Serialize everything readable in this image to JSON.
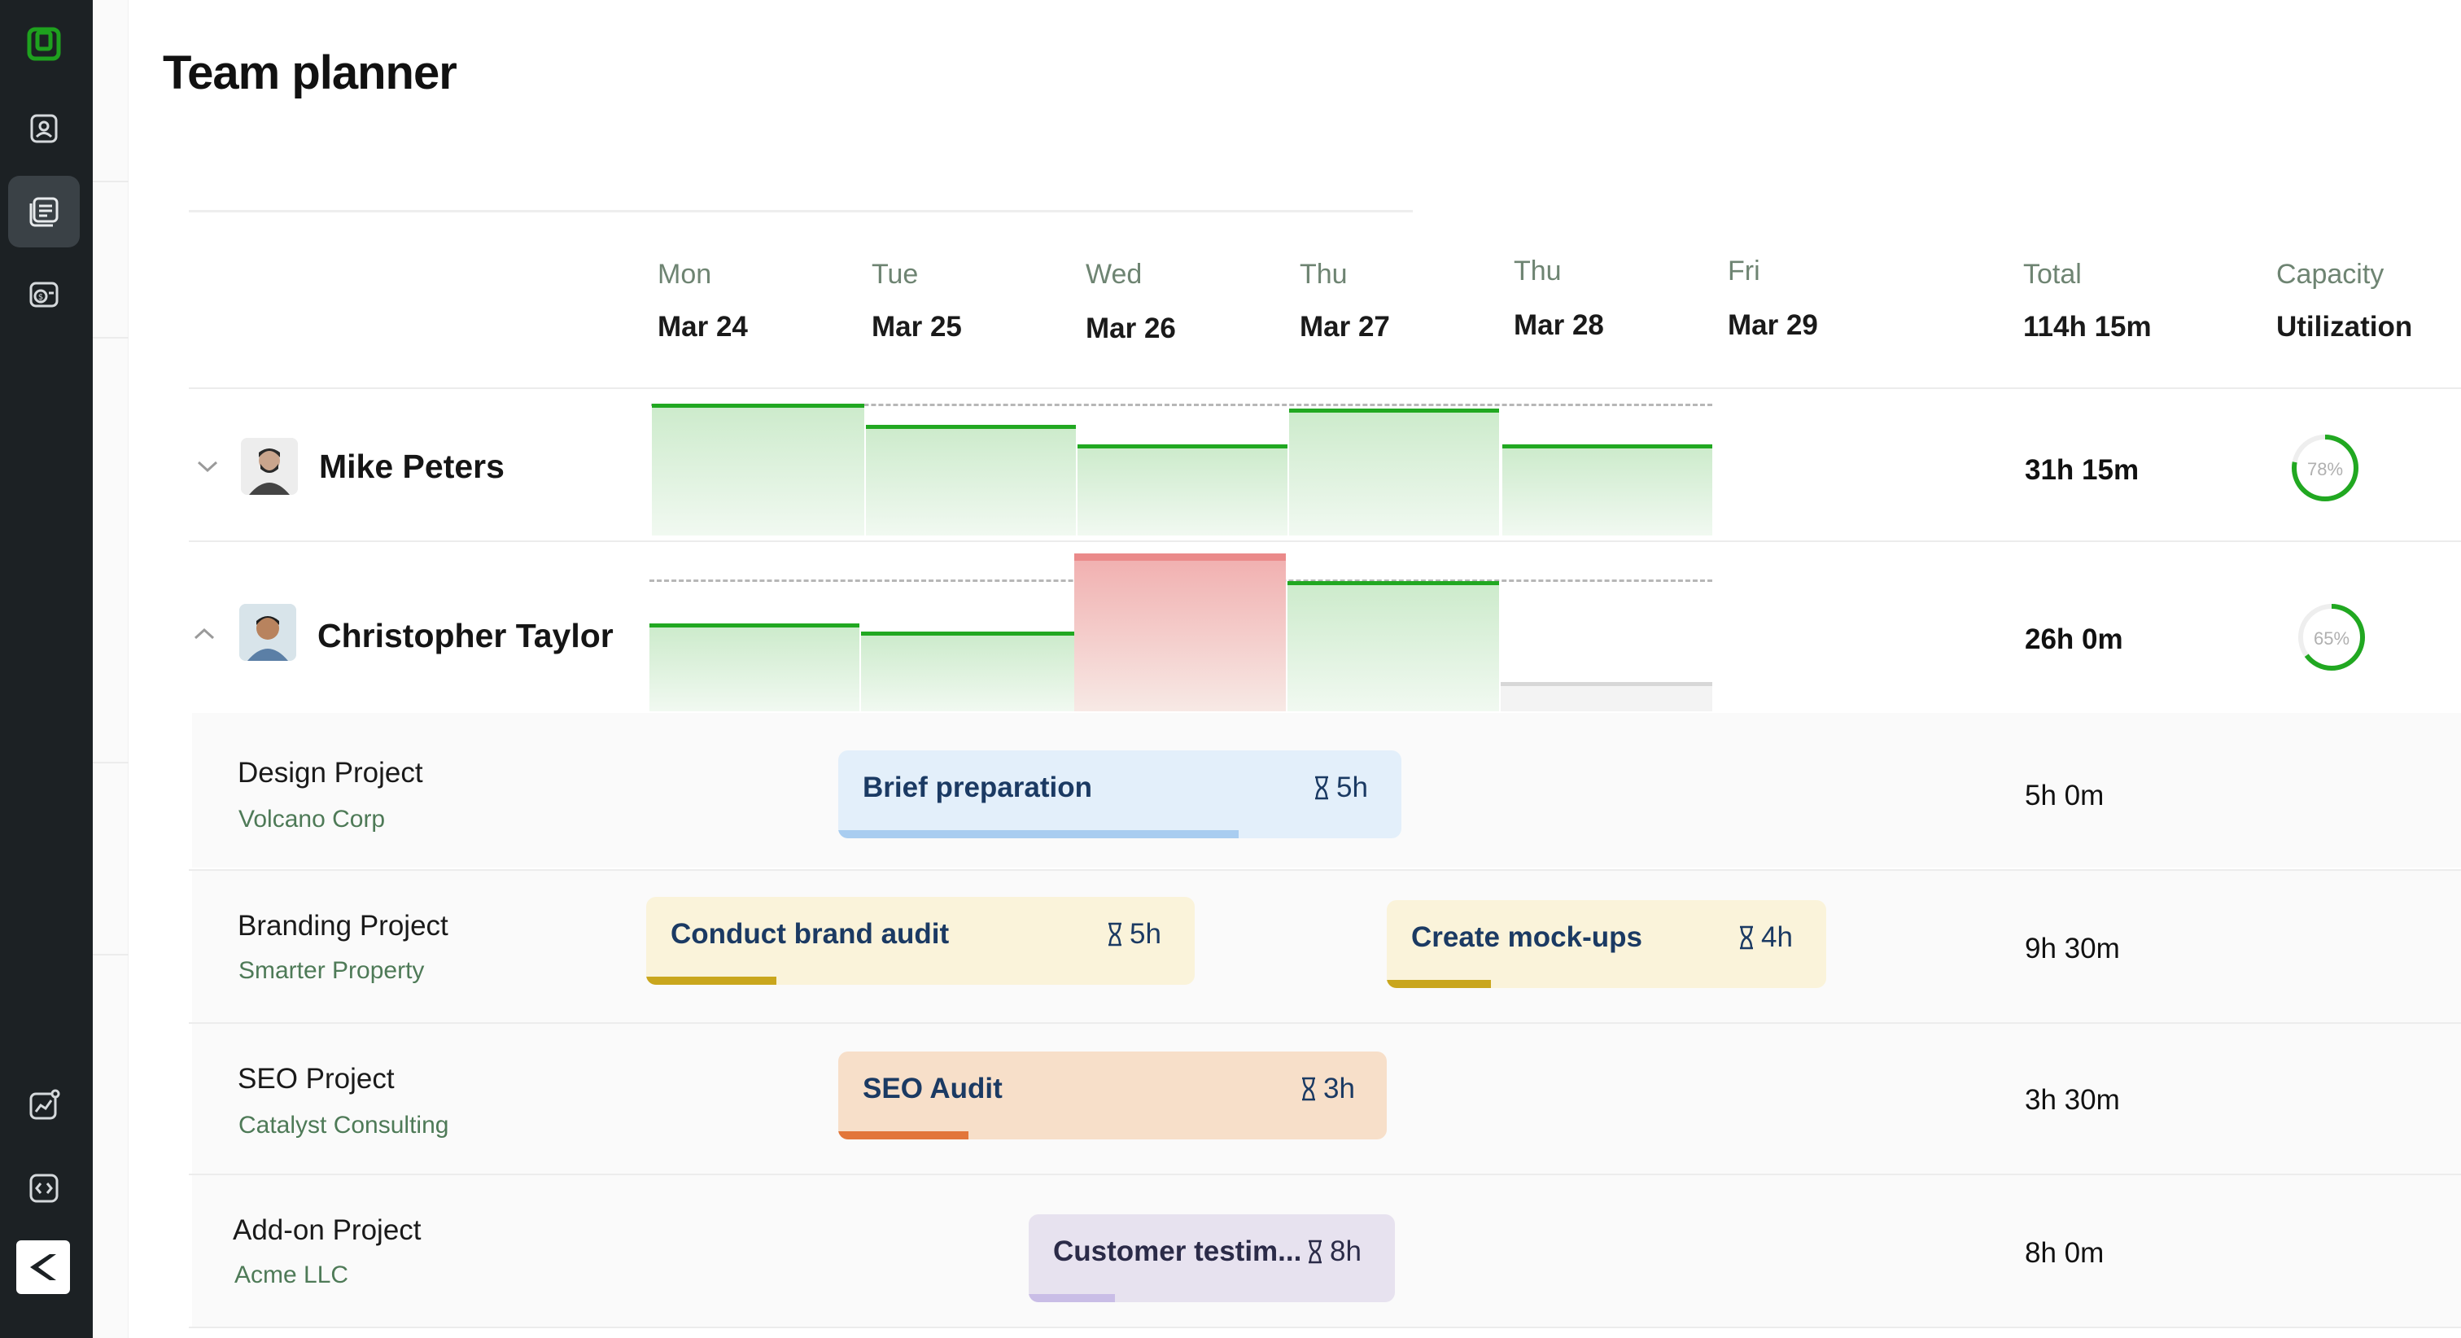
{
  "page": {
    "title": "Team planner"
  },
  "sidebar": {
    "items": [
      {
        "name": "logo-icon",
        "active": false
      },
      {
        "name": "contacts-icon",
        "active": false
      },
      {
        "name": "planner-icon",
        "active": true
      },
      {
        "name": "billing-icon",
        "active": false
      },
      {
        "name": "analytics-icon",
        "active": false
      },
      {
        "name": "code-icon",
        "active": false
      },
      {
        "name": "brand-icon",
        "active": false
      }
    ]
  },
  "header": {
    "days": [
      {
        "day": "Mon",
        "date": "Mar 24"
      },
      {
        "day": "Tue",
        "date": "Mar 25"
      },
      {
        "day": "Wed",
        "date": "Mar 26"
      },
      {
        "day": "Thu",
        "date": "Mar 27"
      },
      {
        "day": "Thu",
        "date": "Mar 28"
      },
      {
        "day": "Fri",
        "date": "Mar 29"
      }
    ],
    "total_label": "Total",
    "total_value": "114h 15m",
    "capacity_label": "Capacity",
    "capacity_sub": "Utilization"
  },
  "people": [
    {
      "name": "Mike Peters",
      "total": "31h 15m",
      "utilization_label": "78%",
      "utilization": 0.78,
      "expanded": false,
      "day_load": [
        1.0,
        0.85,
        0.7,
        0.98,
        0.7
      ]
    },
    {
      "name": "Christopher Taylor",
      "total": "26h 0m",
      "utilization_label": "65%",
      "utilization": 0.65,
      "expanded": true,
      "day_load": [
        0.7,
        0.64,
        1.2,
        1.0,
        0.0
      ]
    }
  ],
  "projects": [
    {
      "name": "Design Project",
      "client": "Volcano Corp",
      "total": "5h 0m",
      "task": {
        "label": "Brief preparation",
        "hours": "5h",
        "progress": 0.71,
        "color": "#e3effa",
        "bar": "#a9cdf0"
      }
    },
    {
      "name": "Branding Project",
      "client": "Smarter Property",
      "total": "9h 30m",
      "tasks": [
        {
          "label": "Conduct brand audit",
          "hours": "5h",
          "progress": 0.24,
          "color": "#faf3da",
          "bar": "#c9a61d"
        },
        {
          "label": "Create mock-ups",
          "hours": "4h",
          "progress": 0.24,
          "color": "#faf3da",
          "bar": "#c9a61d"
        }
      ]
    },
    {
      "name": "SEO Project",
      "client": "Catalyst Consulting",
      "total": "3h 30m",
      "task": {
        "label": "SEO Audit",
        "hours": "3h",
        "progress": 0.24,
        "color": "#f7dfc9",
        "bar": "#e2763a"
      }
    },
    {
      "name": "Add-on Project",
      "client": "Acme LLC",
      "total": "8h 0m",
      "task": {
        "label": "Customer testim...",
        "hours": "8h",
        "progress": 0.24,
        "color": "#e7e2ef",
        "bar": "#c9bde6"
      }
    }
  ],
  "colors": {
    "accent": "#21a821",
    "over": "#ea8a8a",
    "sidebar": "#1c2124"
  }
}
